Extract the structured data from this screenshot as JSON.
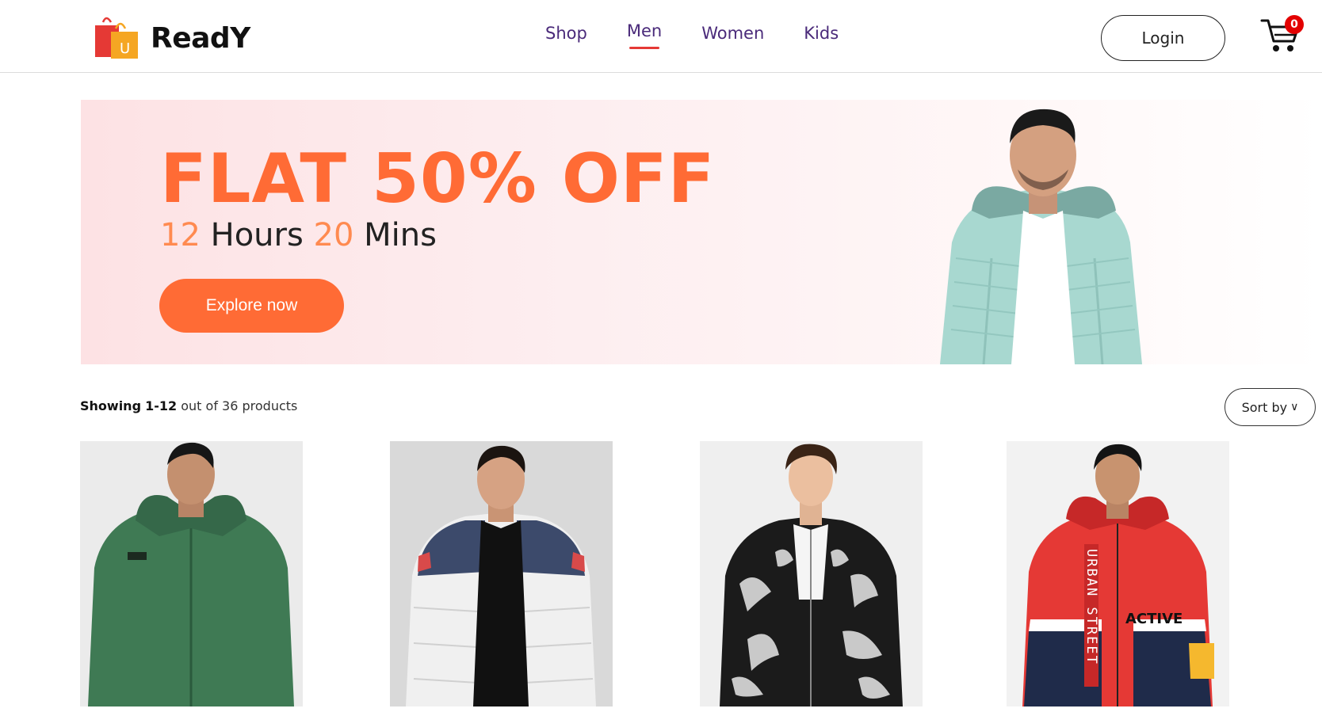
{
  "brand": {
    "name": "ReadY",
    "logo_letter": "U"
  },
  "nav": {
    "items": [
      {
        "label": "Shop",
        "active": false
      },
      {
        "label": "Men",
        "active": true
      },
      {
        "label": "Women",
        "active": false
      },
      {
        "label": "Kids",
        "active": false
      }
    ]
  },
  "header": {
    "login_label": "Login",
    "cart_count": "0"
  },
  "banner": {
    "title": "FLAT 50% OFF",
    "hours_value": "12",
    "hours_label": "Hours",
    "mins_value": "20",
    "mins_label": "Mins",
    "cta_label": "Explore now"
  },
  "listing": {
    "showing_label": "Showing",
    "showing_range": "1-12",
    "showing_rest": "out of 36 products",
    "sort_label": "Sort by"
  },
  "products": [
    {
      "jacket_color": "#3f7a54",
      "bg": "#ebebeb"
    },
    {
      "jacket_color": "#f0f0f0",
      "bg": "#d9d9d9"
    },
    {
      "jacket_color": "#1b1b1b",
      "bg": "#efefef"
    },
    {
      "jacket_color": "#e53935",
      "bg": "#f2f2f2"
    }
  ],
  "colors": {
    "accent": "#ff6b35",
    "nav_text": "#4a2a7a",
    "nav_active_underline": "#e53935",
    "badge": "#e30000"
  }
}
